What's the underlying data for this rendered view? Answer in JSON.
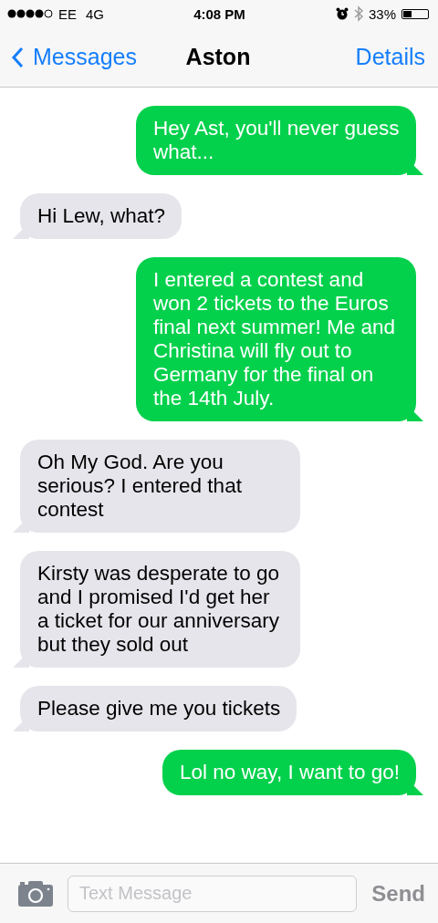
{
  "status_bar": {
    "carrier": "EE",
    "network": "4G",
    "time": "4:08 PM",
    "battery": "33%"
  },
  "nav_bar": {
    "back": "Messages",
    "title": "Aston",
    "action": "Details"
  },
  "messages": [
    {
      "kind": "sent",
      "text": "Hey Ast, you'll never guess what..."
    },
    {
      "kind": "received",
      "text": "Hi Lew, what?"
    },
    {
      "kind": "sent",
      "text": "I entered a contest and won 2 tickets to the Euros final next summer! Me and Christina will fly out to Germany for the final on the 14th July."
    },
    {
      "kind": "received",
      "text": "Oh My God. Are you serious? I entered that contest"
    },
    {
      "kind": "received",
      "text": "Kirsty was desperate to go and I promised I'd get her a ticket for our anniversary but they sold out"
    },
    {
      "kind": "received",
      "text": "Please give me you tickets"
    },
    {
      "kind": "sent",
      "text": "Lol no way, I want to go!"
    }
  ],
  "input_bar": {
    "placeholder": "Text Message",
    "send": "Send"
  }
}
